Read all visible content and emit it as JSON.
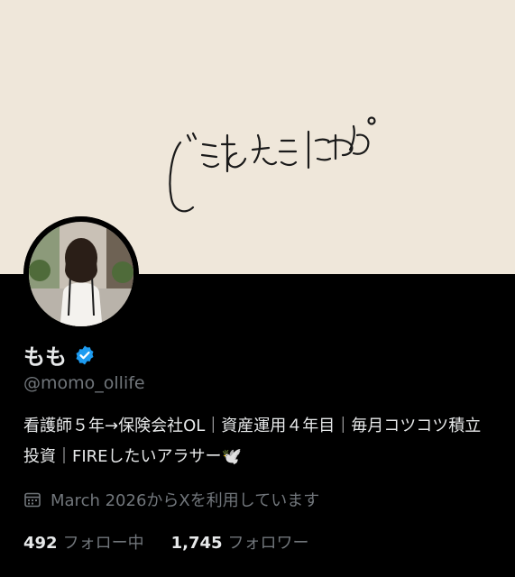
{
  "banner": {
    "text": "できるときにやる。"
  },
  "profile": {
    "name": "もも",
    "handle": "@momo_ollife",
    "bio": "看護師５年→保険会社OL｜資産運用４年目｜毎月コツコツ積立投資｜FIREしたいアラサー🕊️",
    "joined": "March 2026からXを利用しています",
    "following_count": "492",
    "following_label": "フォロー中",
    "followers_count": "1,745",
    "followers_label": "フォロワー"
  },
  "colors": {
    "verified": "#1d9bf0",
    "muted": "#71767b",
    "banner_bg": "#efe7da"
  },
  "icons": [
    "verified-badge-icon",
    "calendar-icon"
  ]
}
